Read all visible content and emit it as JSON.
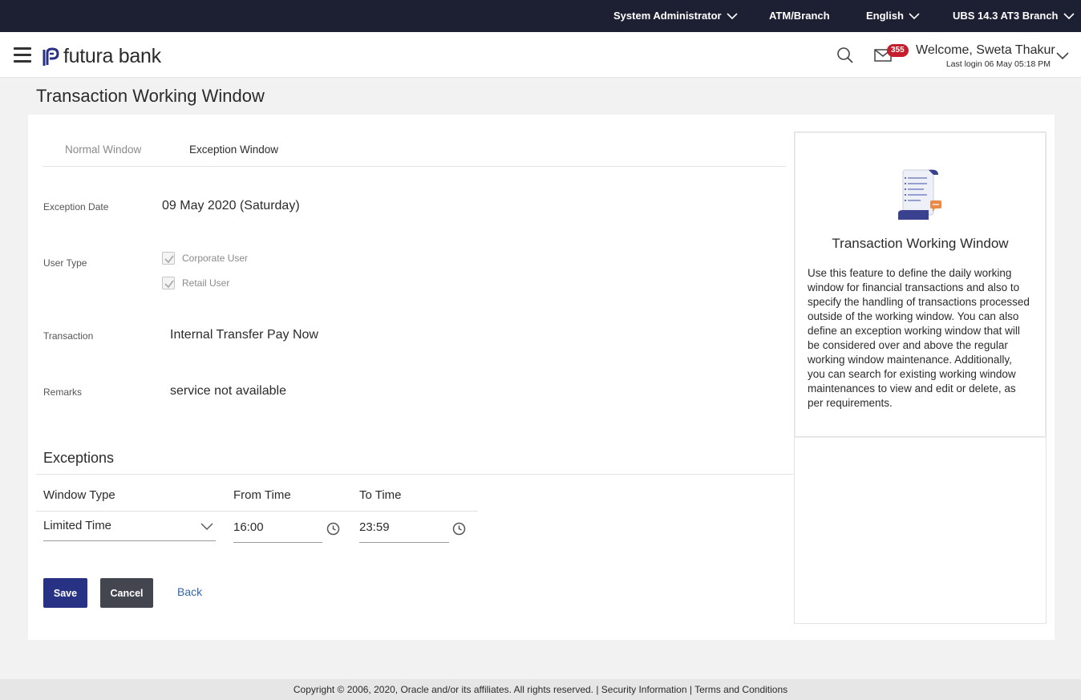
{
  "topbar": {
    "role": "System Administrator",
    "atm_branch": "ATM/Branch",
    "language": "English",
    "branch": "UBS 14.3 AT3 Branch"
  },
  "header": {
    "logo_text": "futura bank",
    "notification_count": "355",
    "welcome": "Welcome, Sweta Thakur",
    "last_login": "Last login 06 May 05:18 PM"
  },
  "page": {
    "title": "Transaction Working Window"
  },
  "tabs": {
    "normal": "Normal Window",
    "exception": "Exception Window"
  },
  "form": {
    "exception_date_label": "Exception Date",
    "exception_date_value": "09 May 2020 (Saturday)",
    "user_type_label": "User Type",
    "user_types": [
      {
        "label": "Corporate User",
        "checked": true
      },
      {
        "label": "Retail User",
        "checked": true
      }
    ],
    "transaction_label": "Transaction",
    "transaction_value": "Internal Transfer Pay Now",
    "remarks_label": "Remarks",
    "remarks_value": "service not available"
  },
  "exceptions": {
    "title": "Exceptions",
    "col_window_type": "Window Type",
    "col_from_time": "From Time",
    "col_to_time": "To Time",
    "window_type_value": "Limited Time",
    "from_time_value": "16:00",
    "to_time_value": "23:59"
  },
  "actions": {
    "save": "Save",
    "cancel": "Cancel",
    "back": "Back"
  },
  "help": {
    "title": "Transaction Working Window",
    "text": "Use this feature to define the daily working window for financial transactions and also to specify the handling of transactions processed outside of the working window. You can also define an exception working window that will be considered over and above the regular working window maintenance. Additionally, you can search for existing working window maintenances to view and edit or delete, as per requirements."
  },
  "footer": {
    "text": "Copyright © 2006, 2020, Oracle and/or its affiliates. All rights reserved. | Security Information | Terms and Conditions"
  },
  "colors": {
    "topbar_bg": "#1d2033",
    "primary_button": "#283285",
    "secondary_button": "#43464f",
    "badge": "#c41e2c",
    "link": "#3567a9"
  }
}
